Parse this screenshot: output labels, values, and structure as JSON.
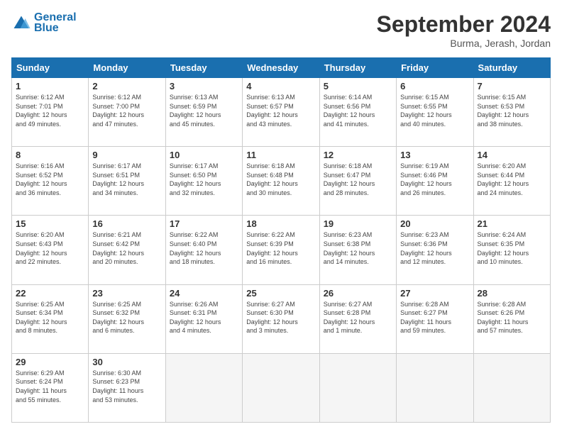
{
  "header": {
    "logo_line1": "General",
    "logo_line2": "Blue",
    "title": "September 2024",
    "subtitle": "Burma, Jerash, Jordan"
  },
  "days_of_week": [
    "Sunday",
    "Monday",
    "Tuesday",
    "Wednesday",
    "Thursday",
    "Friday",
    "Saturday"
  ],
  "weeks": [
    [
      {
        "day": 1,
        "info": "Sunrise: 6:12 AM\nSunset: 7:01 PM\nDaylight: 12 hours\nand 49 minutes."
      },
      {
        "day": 2,
        "info": "Sunrise: 6:12 AM\nSunset: 7:00 PM\nDaylight: 12 hours\nand 47 minutes."
      },
      {
        "day": 3,
        "info": "Sunrise: 6:13 AM\nSunset: 6:59 PM\nDaylight: 12 hours\nand 45 minutes."
      },
      {
        "day": 4,
        "info": "Sunrise: 6:13 AM\nSunset: 6:57 PM\nDaylight: 12 hours\nand 43 minutes."
      },
      {
        "day": 5,
        "info": "Sunrise: 6:14 AM\nSunset: 6:56 PM\nDaylight: 12 hours\nand 41 minutes."
      },
      {
        "day": 6,
        "info": "Sunrise: 6:15 AM\nSunset: 6:55 PM\nDaylight: 12 hours\nand 40 minutes."
      },
      {
        "day": 7,
        "info": "Sunrise: 6:15 AM\nSunset: 6:53 PM\nDaylight: 12 hours\nand 38 minutes."
      }
    ],
    [
      {
        "day": 8,
        "info": "Sunrise: 6:16 AM\nSunset: 6:52 PM\nDaylight: 12 hours\nand 36 minutes."
      },
      {
        "day": 9,
        "info": "Sunrise: 6:17 AM\nSunset: 6:51 PM\nDaylight: 12 hours\nand 34 minutes."
      },
      {
        "day": 10,
        "info": "Sunrise: 6:17 AM\nSunset: 6:50 PM\nDaylight: 12 hours\nand 32 minutes."
      },
      {
        "day": 11,
        "info": "Sunrise: 6:18 AM\nSunset: 6:48 PM\nDaylight: 12 hours\nand 30 minutes."
      },
      {
        "day": 12,
        "info": "Sunrise: 6:18 AM\nSunset: 6:47 PM\nDaylight: 12 hours\nand 28 minutes."
      },
      {
        "day": 13,
        "info": "Sunrise: 6:19 AM\nSunset: 6:46 PM\nDaylight: 12 hours\nand 26 minutes."
      },
      {
        "day": 14,
        "info": "Sunrise: 6:20 AM\nSunset: 6:44 PM\nDaylight: 12 hours\nand 24 minutes."
      }
    ],
    [
      {
        "day": 15,
        "info": "Sunrise: 6:20 AM\nSunset: 6:43 PM\nDaylight: 12 hours\nand 22 minutes."
      },
      {
        "day": 16,
        "info": "Sunrise: 6:21 AM\nSunset: 6:42 PM\nDaylight: 12 hours\nand 20 minutes."
      },
      {
        "day": 17,
        "info": "Sunrise: 6:22 AM\nSunset: 6:40 PM\nDaylight: 12 hours\nand 18 minutes."
      },
      {
        "day": 18,
        "info": "Sunrise: 6:22 AM\nSunset: 6:39 PM\nDaylight: 12 hours\nand 16 minutes."
      },
      {
        "day": 19,
        "info": "Sunrise: 6:23 AM\nSunset: 6:38 PM\nDaylight: 12 hours\nand 14 minutes."
      },
      {
        "day": 20,
        "info": "Sunrise: 6:23 AM\nSunset: 6:36 PM\nDaylight: 12 hours\nand 12 minutes."
      },
      {
        "day": 21,
        "info": "Sunrise: 6:24 AM\nSunset: 6:35 PM\nDaylight: 12 hours\nand 10 minutes."
      }
    ],
    [
      {
        "day": 22,
        "info": "Sunrise: 6:25 AM\nSunset: 6:34 PM\nDaylight: 12 hours\nand 8 minutes."
      },
      {
        "day": 23,
        "info": "Sunrise: 6:25 AM\nSunset: 6:32 PM\nDaylight: 12 hours\nand 6 minutes."
      },
      {
        "day": 24,
        "info": "Sunrise: 6:26 AM\nSunset: 6:31 PM\nDaylight: 12 hours\nand 4 minutes."
      },
      {
        "day": 25,
        "info": "Sunrise: 6:27 AM\nSunset: 6:30 PM\nDaylight: 12 hours\nand 3 minutes."
      },
      {
        "day": 26,
        "info": "Sunrise: 6:27 AM\nSunset: 6:28 PM\nDaylight: 12 hours\nand 1 minute."
      },
      {
        "day": 27,
        "info": "Sunrise: 6:28 AM\nSunset: 6:27 PM\nDaylight: 11 hours\nand 59 minutes."
      },
      {
        "day": 28,
        "info": "Sunrise: 6:28 AM\nSunset: 6:26 PM\nDaylight: 11 hours\nand 57 minutes."
      }
    ],
    [
      {
        "day": 29,
        "info": "Sunrise: 6:29 AM\nSunset: 6:24 PM\nDaylight: 11 hours\nand 55 minutes."
      },
      {
        "day": 30,
        "info": "Sunrise: 6:30 AM\nSunset: 6:23 PM\nDaylight: 11 hours\nand 53 minutes."
      },
      {
        "day": null,
        "info": ""
      },
      {
        "day": null,
        "info": ""
      },
      {
        "day": null,
        "info": ""
      },
      {
        "day": null,
        "info": ""
      },
      {
        "day": null,
        "info": ""
      }
    ]
  ]
}
